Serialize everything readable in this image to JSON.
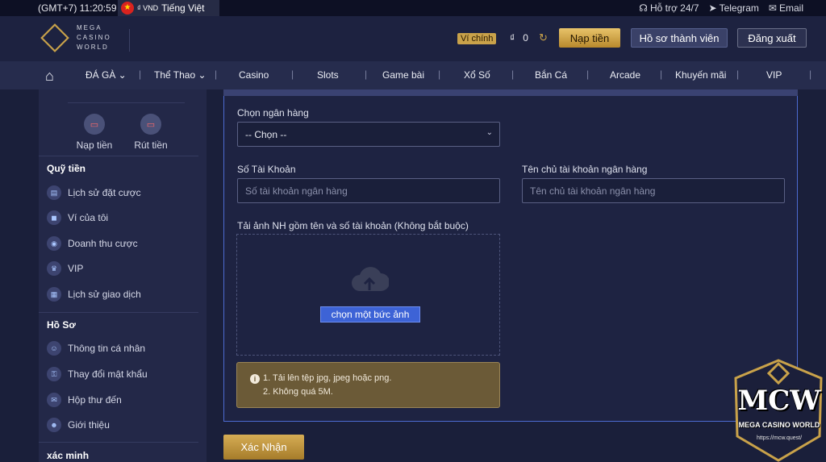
{
  "topbar": {
    "time": "(GMT+7) 11:20:59",
    "currency": "₫ VND",
    "language": "Tiếng Việt",
    "support": "Hỗ trợ 24/7",
    "telegram": "Telegram",
    "email": "Email"
  },
  "header": {
    "logo_line1": "MEGA",
    "logo_line2": "CASINO",
    "logo_line3": "WORLD",
    "wallet_tag": "Ví chính",
    "currency_symbol": "₫",
    "balance": "0",
    "deposit_label": "Nạp tiền",
    "profile_label": "Hồ sơ thành viên",
    "logout_label": "Đăng xuất"
  },
  "nav": {
    "items": [
      "ĐÁ GÀ",
      "Thể Thao",
      "Casino",
      "Slots",
      "Game bài",
      "Xổ Số",
      "Bắn Cá",
      "Arcade",
      "Khuyến mãi",
      "VIP"
    ]
  },
  "sidebar": {
    "quick_actions": [
      "Nạp tiền",
      "Rút tiền"
    ],
    "section1_title": "Quỹ tiền",
    "section1_items": [
      "Lịch sử đặt cược",
      "Ví của tôi",
      "Doanh thu cược",
      "VIP",
      "Lịch sử giao dịch"
    ],
    "section2_title": "Hồ Sơ",
    "section2_items": [
      "Thông tin cá nhân",
      "Thay đổi mật khẩu",
      "Hộp thư đến",
      "Giới thiệu"
    ],
    "section3_title": "xác minh"
  },
  "form": {
    "bank_label": "Chọn ngân hàng",
    "bank_value": "-- Chọn --",
    "account_label": "Số Tài Khoản",
    "account_placeholder": "Số tài khoản ngân hàng",
    "holder_label": "Tên chủ tài khoản ngân hàng",
    "holder_placeholder": "Tên chủ tài khoản ngân hàng",
    "upload_label": "Tải ảnh NH gồm tên và số tài khoản (Không bắt buộc)",
    "upload_button": "chọn một bức ảnh",
    "note_line1": "1. Tải lên tệp jpg, jpeg hoặc png.",
    "note_line2": "2. Không quá 5M.",
    "confirm_label": "Xác Nhận"
  },
  "watermark": {
    "big": "MCW",
    "sub": "MEGA CASINO WORLD",
    "url": "https://mcw.quest/"
  },
  "colors": {
    "accent_gold": "#c9a24a",
    "primary_blue": "#3d63d6",
    "background": "#1a1f3a"
  }
}
